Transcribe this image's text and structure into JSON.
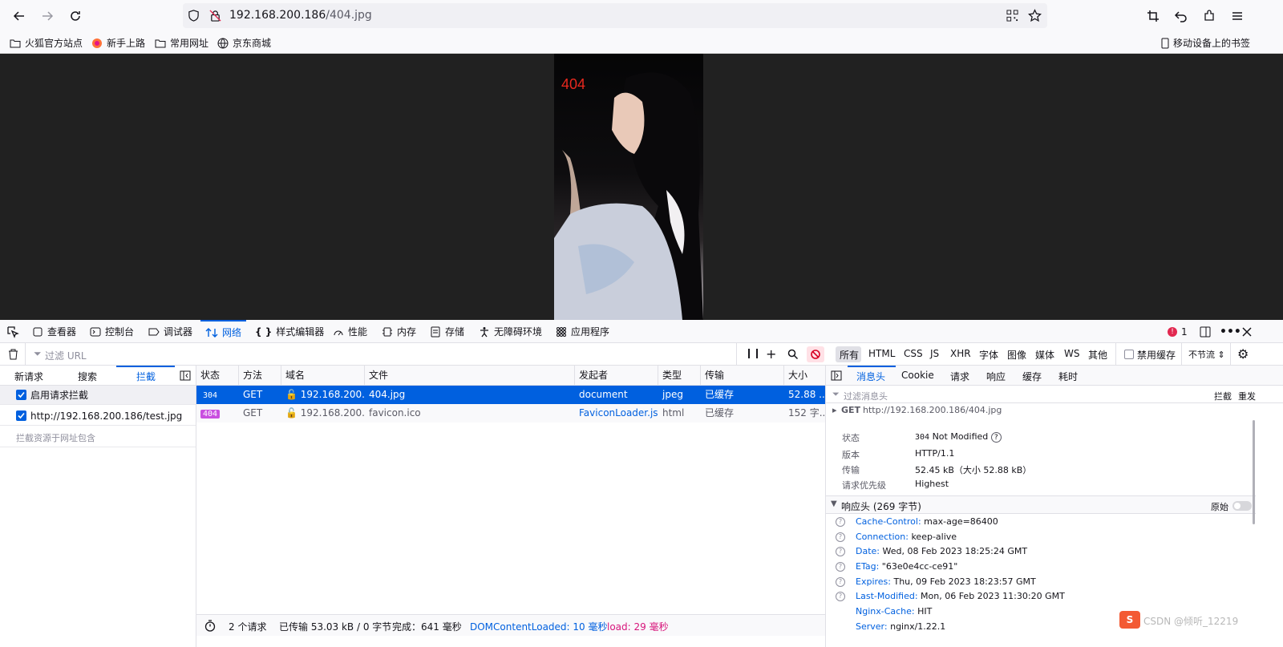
{
  "browser": {
    "url_host": "192.168.200.186",
    "url_path": "/404.jpg"
  },
  "bookmarks": [
    {
      "label": "火狐官方站点",
      "icon": "folder-icon"
    },
    {
      "label": "新手上路",
      "icon": "firefox-icon"
    },
    {
      "label": "常用网址",
      "icon": "folder-icon"
    },
    {
      "label": "京东商城",
      "icon": "globe-icon"
    }
  ],
  "mobile_bookmarks": "移动设备上的书签",
  "page": {
    "image_caption": "404"
  },
  "devtools": {
    "tabs": [
      "查看器",
      "控制台",
      "调试器",
      "网络",
      "样式编辑器",
      "性能",
      "内存",
      "存储",
      "无障碍环境",
      "应用程序"
    ],
    "error_count": "1",
    "filter_placeholder": "过滤 URL",
    "type_filters": [
      "所有",
      "HTML",
      "CSS",
      "JS",
      "XHR",
      "字体",
      "图像",
      "媒体",
      "WS",
      "其他"
    ],
    "disable_cache": "禁用缓存",
    "throttle": "不节流 ⇕"
  },
  "left_panel": {
    "tabs": [
      "新请求",
      "搜索",
      "拦截"
    ],
    "enable_intercept": "启用请求拦截",
    "intercept_url": "http://192.168.200.186/test.jpg",
    "intercept_placeholder": "拦截资源于网址包含"
  },
  "table": {
    "columns": [
      "状态",
      "方法",
      "域名",
      "文件",
      "发起者",
      "类型",
      "传输",
      "大小"
    ],
    "rows": [
      {
        "status": "304",
        "method": "GET",
        "domain": "192.168.200.1...",
        "file": "404.jpg",
        "initiator": "document",
        "type": "jpeg",
        "transfer": "已缓存",
        "size": "52.88 ..."
      },
      {
        "status": "404",
        "method": "GET",
        "domain": "192.168.200.1...",
        "file": "favicon.ico",
        "initiator": "FaviconLoader.js...",
        "type": "html",
        "transfer": "已缓存",
        "size": "152 字..."
      }
    ]
  },
  "status_bar": {
    "requests": "2 个请求",
    "transferred": "已传输 53.03 kB / 0 字节",
    "finish": "完成：641 毫秒",
    "dom_loaded": "DOMContentLoaded: 10 毫秒",
    "load": "load: 29 毫秒"
  },
  "right_panel": {
    "tabs": [
      "消息头",
      "Cookie",
      "请求",
      "响应",
      "缓存",
      "耗时"
    ],
    "filter_placeholder": "过滤消息头",
    "block": "拦截",
    "resend": "重发",
    "request_line_method": "GET",
    "request_line_url": "http://192.168.200.186/404.jpg",
    "summary": [
      {
        "key": "状态",
        "code": "304",
        "value": "Not Modified"
      },
      {
        "key": "版本",
        "value": "HTTP/1.1"
      },
      {
        "key": "传输",
        "value": "52.45 kB（大小 52.88 kB）"
      },
      {
        "key": "请求优先级",
        "value": "Highest"
      }
    ],
    "response_headers_title": "响应头 (269 字节)",
    "raw_label": "原始",
    "headers": [
      {
        "name": "Cache-Control:",
        "value": "max-age=86400"
      },
      {
        "name": "Connection:",
        "value": "keep-alive"
      },
      {
        "name": "Date:",
        "value": "Wed, 08 Feb 2023 18:25:24 GMT"
      },
      {
        "name": "ETag:",
        "value": "\"63e0e4cc-ce91\""
      },
      {
        "name": "Expires:",
        "value": "Thu, 09 Feb 2023 18:23:57 GMT"
      },
      {
        "name": "Last-Modified:",
        "value": "Mon, 06 Feb 2023 11:30:20 GMT"
      },
      {
        "name": "Nginx-Cache:",
        "value": "HIT"
      },
      {
        "name": "Server:",
        "value": "nginx/1.22.1"
      }
    ]
  },
  "watermark": "CSDN @倾听_12219",
  "colors": {
    "accent": "#0060df",
    "status_404": "#c94fe0",
    "load": "#d7157b"
  }
}
